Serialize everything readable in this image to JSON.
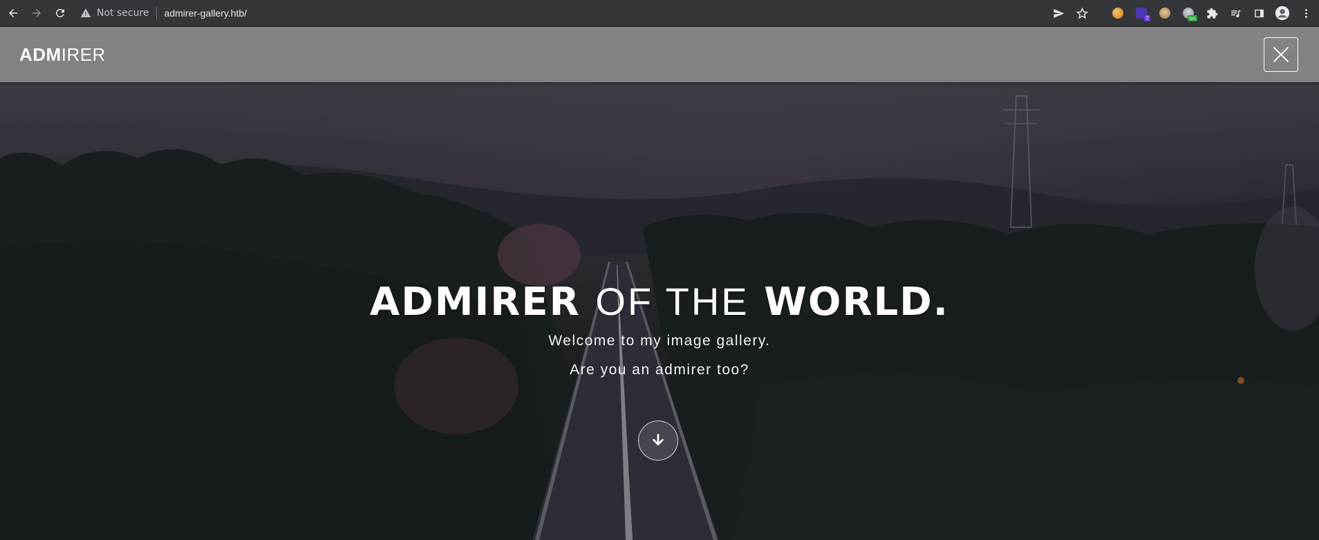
{
  "browser": {
    "security_label": "Not secure",
    "url": "admirer-gallery.htb/",
    "extensions": [
      {
        "icon": "extension-orange-icon",
        "color": "#e8a33a"
      },
      {
        "icon": "extension-purple-icon",
        "color": "#5b3cc4",
        "badge": "7",
        "badge_color": "#6a3fd6"
      },
      {
        "icon": "extension-face-icon",
        "color": "#c9a36b"
      },
      {
        "icon": "extension-globe-icon",
        "color": "#9aa0a6",
        "badge": "on",
        "badge_color": "#2a9d3a"
      }
    ]
  },
  "site": {
    "logo_bold": "ADM",
    "logo_light": "IRER"
  },
  "hero": {
    "title_part1": "ADMIRER",
    "title_part2": "OF THE",
    "title_part3": "WORLD.",
    "subtitle_1": "Welcome to my image gallery.",
    "subtitle_2": "Are you an admirer too?"
  },
  "colors": {
    "header_bg": "#969696",
    "text": "#ffffff",
    "browser_bar": "#35363a"
  }
}
